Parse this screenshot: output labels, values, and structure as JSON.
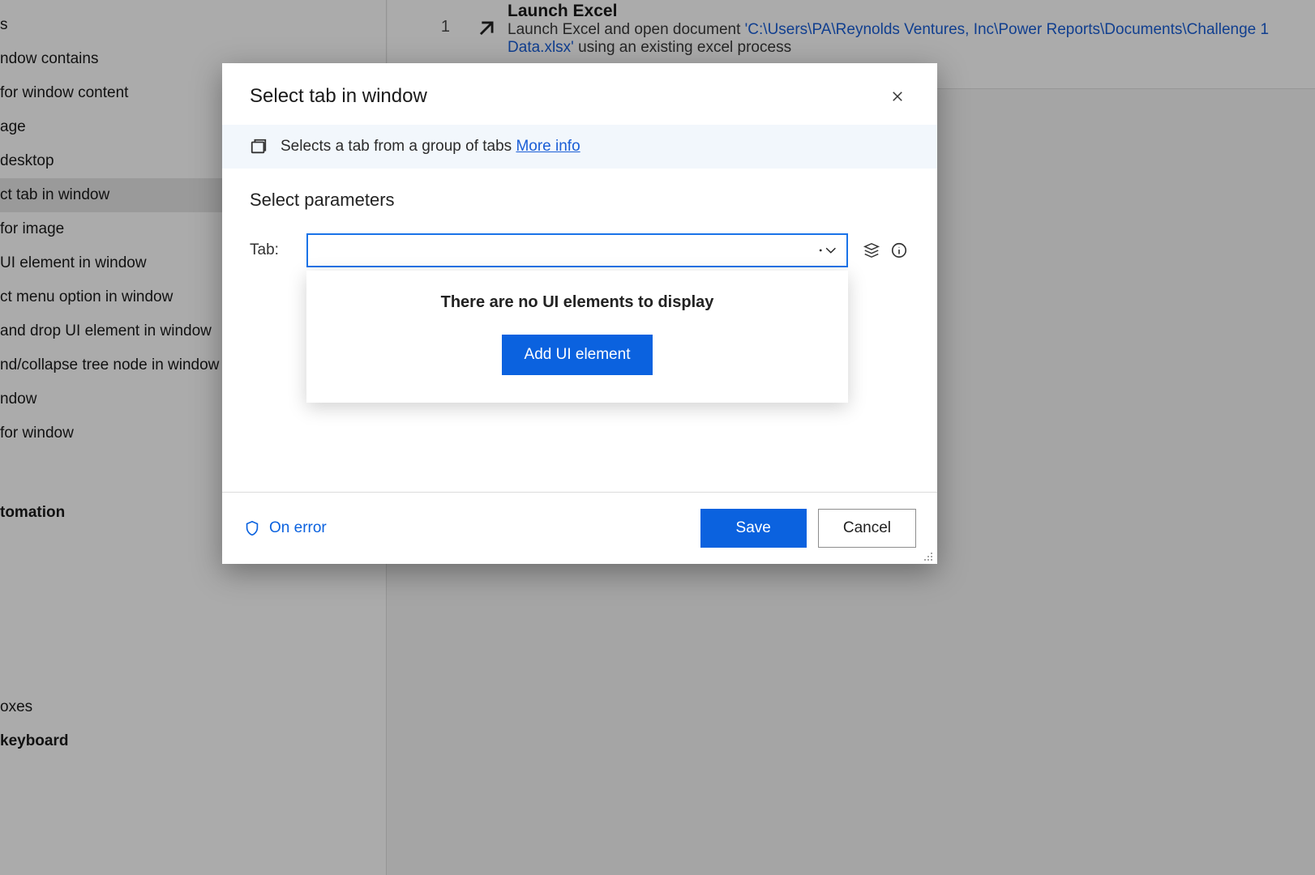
{
  "sidebar": {
    "items": [
      {
        "label": "s",
        "bold": false,
        "selected": false
      },
      {
        "label": "ndow contains",
        "bold": false,
        "selected": false
      },
      {
        "label": "for window content",
        "bold": false,
        "selected": false
      },
      {
        "label": "age",
        "bold": false,
        "selected": false
      },
      {
        "label": "desktop",
        "bold": false,
        "selected": false
      },
      {
        "label": "ct tab in window",
        "bold": false,
        "selected": true
      },
      {
        "label": "for image",
        "bold": false,
        "selected": false
      },
      {
        "label": "UI element in window",
        "bold": false,
        "selected": false
      },
      {
        "label": "ct menu option in window",
        "bold": false,
        "selected": false
      },
      {
        "label": "and drop UI element in window",
        "bold": false,
        "selected": false
      },
      {
        "label": "nd/collapse tree node in window",
        "bold": false,
        "selected": false
      },
      {
        "label": "ndow",
        "bold": false,
        "selected": false
      },
      {
        "label": "for window",
        "bold": false,
        "selected": false
      },
      {
        "label": "tomation",
        "bold": true,
        "selected": false
      },
      {
        "label": "oxes",
        "bold": false,
        "selected": false
      },
      {
        "label": "keyboard",
        "bold": true,
        "selected": false
      }
    ]
  },
  "flow": {
    "step_number": "1",
    "title": "Launch Excel",
    "desc_prefix": "Launch Excel and open document ",
    "path": "'C:\\Users\\PA\\Reynolds Ventures, Inc\\Power Reports\\Documents\\Challenge 1 Data.xlsx'",
    "desc_suffix": " using an existing excel process"
  },
  "modal": {
    "title": "Select tab in window",
    "desc": "Selects a tab from a group of tabs",
    "more_info": "More info",
    "section_title": "Select parameters",
    "param_label": "Tab:",
    "tab_value": "",
    "dropdown_empty": "There are no UI elements to display",
    "add_button": "Add UI element",
    "on_error": "On error",
    "save": "Save",
    "cancel": "Cancel"
  }
}
